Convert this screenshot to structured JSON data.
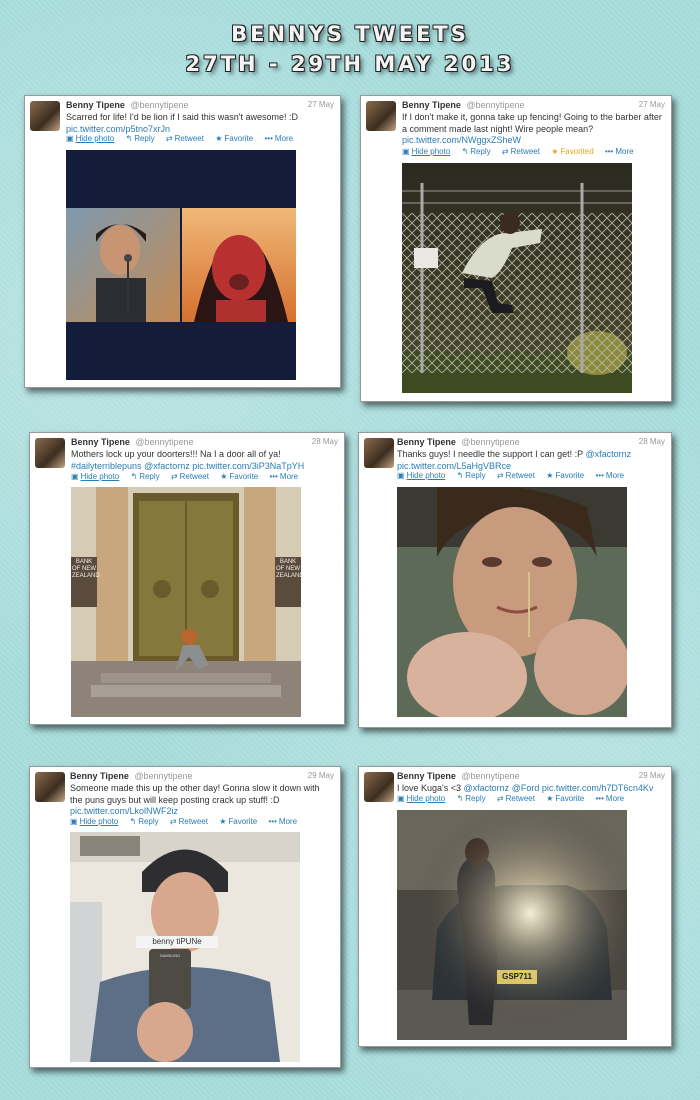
{
  "page": {
    "title_line1": "Bennys Tweets",
    "title_line2": "27th - 29th  May 2013"
  },
  "actions": {
    "hide_photo": "Hide photo",
    "reply": "Reply",
    "retweet": "Retweet",
    "favorite": "Favorite",
    "favorited": "Favorited",
    "more": "More"
  },
  "tweets": [
    {
      "name": "Benny Tipene",
      "handle": "@bennytipene",
      "date": "27 May",
      "text": "Scarred for life! I'd be lion if I said this wasn't awesome! :D",
      "link": "pic.twitter.com/p5tno7xrJn",
      "photo_caption": ""
    },
    {
      "name": "Benny Tipene",
      "handle": "@bennytipene",
      "date": "27 May",
      "text": "If I don't make it, gonna take up fencing! Going to the barber after a comment made last night! Wire people mean?",
      "link": "pic.twitter.com/NWggxZSheW",
      "photo_caption": ""
    },
    {
      "name": "Benny Tipene",
      "handle": "@bennytipene",
      "date": "28 May",
      "text": "Mothers lock up your doorters!!! Na I a door all of ya!",
      "hashtag": "#dailyterriblepuns",
      "mention": "@xfactornz",
      "link": "pic.twitter.com/3iP3NaTpYH",
      "sign_left": "BANK OF NEW ZEALAND",
      "sign_right": "BANK OF NEW ZEALAND"
    },
    {
      "name": "Benny Tipene",
      "handle": "@bennytipene",
      "date": "28 May",
      "text": "Thanks guys! I needle the support I can get! :P",
      "mention": "@xfactornz",
      "link": "pic.twitter.com/L5aHgVBRce"
    },
    {
      "name": "Benny Tipene",
      "handle": "@bennytipene",
      "date": "29 May",
      "text": "Someone made this up the other day! Gonna slow it down with the puns guys but will keep posting crack up stuff! :D",
      "link": "pic.twitter.com/LkolNWF2iz",
      "photo_label": "benny tiPUNe",
      "phone_brand": "SAMSUNG"
    },
    {
      "name": "Benny Tipene",
      "handle": "@bennytipene",
      "date": "29 May",
      "text": "I love Kuga's <3",
      "mention1": "@xfactornz",
      "mention2": "@Ford",
      "link": "pic.twitter.com/h7DT6cn4Kv",
      "plate": "GSP711"
    }
  ]
}
